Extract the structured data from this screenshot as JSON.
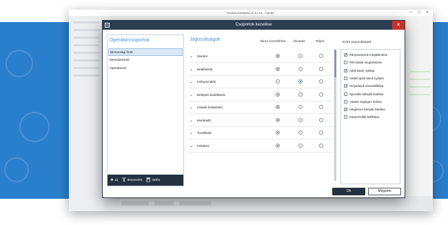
{
  "outer_window": {
    "title": "Prodcor Enterprise v1.3.1.14 - \"Carrier\""
  },
  "dialog": {
    "title": "Csoportok kezelése",
    "close_glyph": "✕"
  },
  "groups_panel": {
    "title": "Operátorcsoportok",
    "items": [
      {
        "label": "Biztonsági őrök",
        "selected": true
      },
      {
        "label": "Menedzserek",
        "selected": false
      },
      {
        "label": "Operátorok",
        "selected": false
      }
    ],
    "toolbar": {
      "new_label": "Új",
      "rename_label": "átnevezés",
      "delete_label": "törlés"
    }
  },
  "rights": {
    "title": "Jogosultságok",
    "columns": [
      "Nincs hozzáférés",
      "Olvasás",
      "Teljes"
    ],
    "rows": [
      {
        "label": "Monitor",
        "selected": 0
      },
      {
        "label": "Beállítások",
        "selected": 0
      },
      {
        "label": "Felhasználók",
        "selected": 1
      },
      {
        "label": "Belépési beállítások",
        "selected": 0
      },
      {
        "label": "Haladó beléptetés",
        "selected": 0
      },
      {
        "label": "Munkaidő",
        "selected": 0
      },
      {
        "label": "Továbbiak",
        "selected": 0
      },
      {
        "label": "Feltöltés",
        "selected": 0
      }
    ]
  },
  "extra_rights": {
    "title": "Extra jogosultságok",
    "items": [
      {
        "label": "Kártyaszámok megtekintése",
        "checked": true
      },
      {
        "label": "PIN kódok megtekintése",
        "checked": false
      },
      {
        "label": "Ajtók távoli nyitása",
        "checked": true
      },
      {
        "label": "Védett ajtók távoli nyitása",
        "checked": false
      },
      {
        "label": "Helyadatok visszaállítása",
        "checked": true
      },
      {
        "label": "Speciális kártyák kiadása",
        "checked": false
      },
      {
        "label": "Adatok végleges törlése",
        "checked": false
      },
      {
        "label": "Ideiglenes kártyák kiadása",
        "checked": true
      },
      {
        "label": "Katasztrófák leállítása",
        "checked": false
      }
    ]
  },
  "buttons": {
    "ok_label": "Ok",
    "cancel_label": "Mégsem"
  },
  "colors": {
    "accent": "#4d8fd0",
    "titlebar": "#2c3e52",
    "band": "#2a7fcd",
    "close": "#c7312c"
  }
}
